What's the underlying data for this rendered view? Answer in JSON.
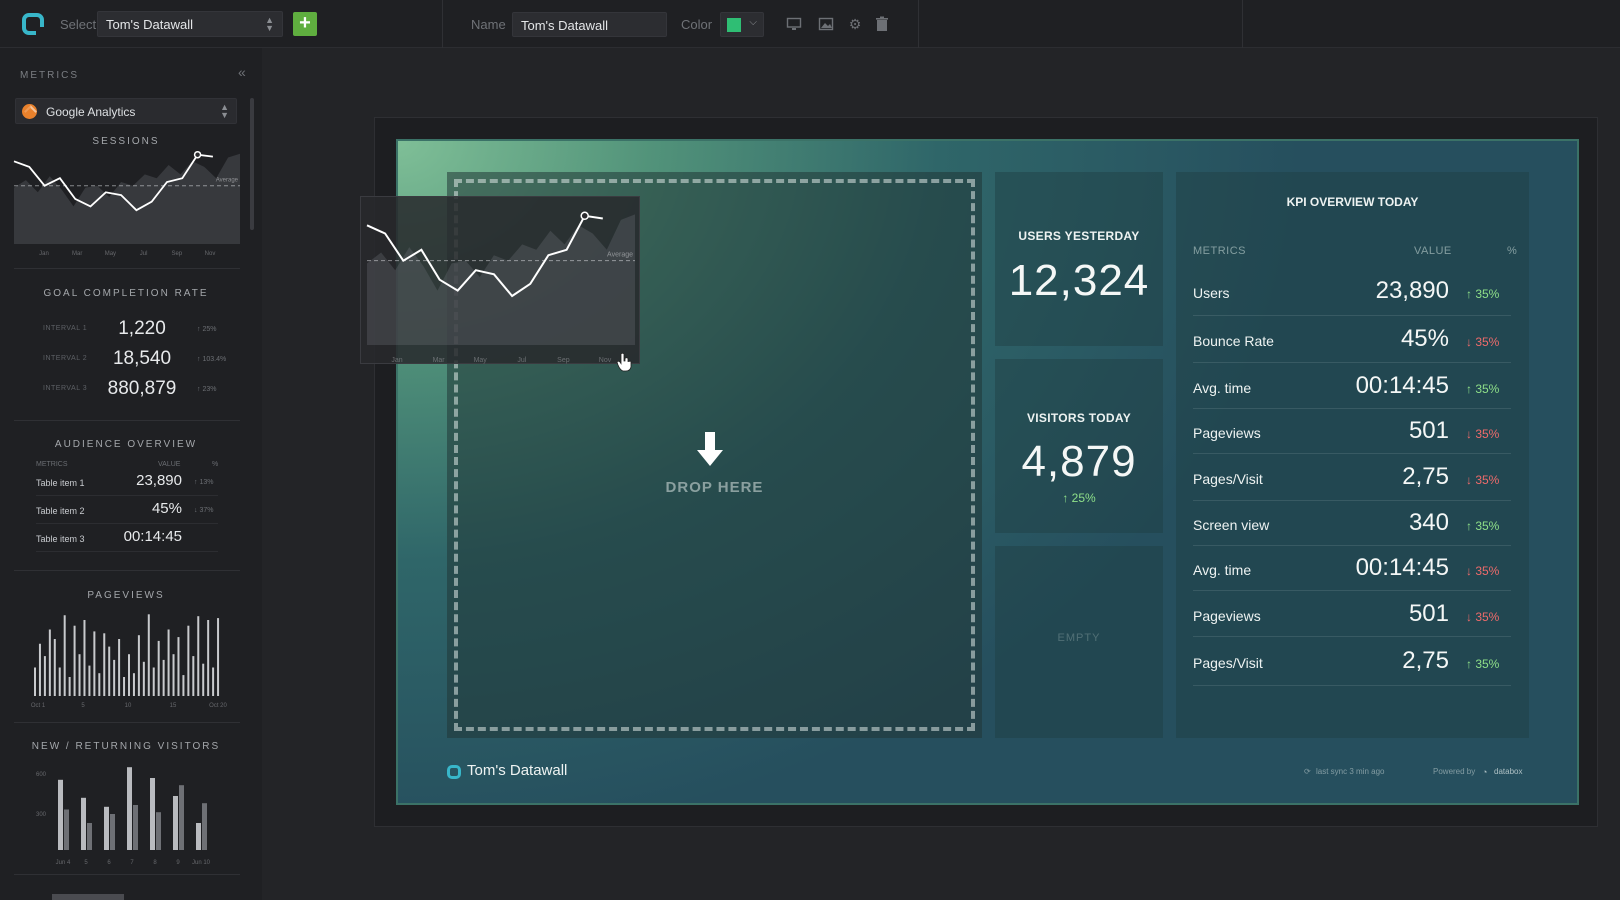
{
  "topbar": {
    "select_label": "Select",
    "select_value": "Tom's Datawall",
    "add_icon": "plus-icon",
    "name_label": "Name",
    "name_value": "Tom's Datawall",
    "color_label": "Color",
    "color_value": "#2fbe74",
    "icons": [
      "monitor-icon",
      "image-icon",
      "gear-icon",
      "trash-icon"
    ]
  },
  "sidebar": {
    "title": "METRICS",
    "collapse_icon": "double-chevron-left-icon",
    "source": "Google Analytics",
    "sessions": {
      "title": "SESSIONS",
      "average_label": "Average",
      "line": [
        88,
        82,
        62,
        70,
        48,
        40,
        55,
        52,
        36,
        45,
        66,
        70,
        95,
        93
      ],
      "area": [
        60,
        68,
        55,
        72,
        58,
        40,
        60,
        62,
        50,
        66,
        62,
        74,
        70,
        84,
        74,
        88,
        82,
        70,
        92,
        96
      ],
      "average": 62,
      "x_ticks": [
        "Jan",
        "Mar",
        "May",
        "Jul",
        "Sep",
        "Nov"
      ]
    },
    "goal_completion": {
      "title": "GOAL COMPLETION RATE",
      "rows": [
        {
          "label": "INTERVAL 1",
          "value": "1,220",
          "change": "↑ 25%"
        },
        {
          "label": "INTERVAL 2",
          "value": "18,540",
          "change": "↑ 103.4%"
        },
        {
          "label": "INTERVAL 3",
          "value": "880,879",
          "change": "↑ 23%"
        }
      ]
    },
    "audience_overview": {
      "title": "AUDIENCE OVERVIEW",
      "headers": [
        "METRICS",
        "VALUE",
        "%"
      ],
      "rows": [
        {
          "name": "Table item 1",
          "value": "23,890",
          "pct": "↑ 13%"
        },
        {
          "name": "Table item 2",
          "value": "45%",
          "pct": "↓ 37%"
        },
        {
          "name": "Table item 3",
          "value": "00:14:45",
          "pct": ""
        }
      ]
    },
    "pageviews": {
      "title": "PAGEVIEWS",
      "bars": [
        30,
        55,
        42,
        70,
        60,
        30,
        85,
        20,
        74,
        44,
        80,
        32,
        68,
        24,
        66,
        52,
        38,
        60,
        20,
        44,
        24,
        64,
        36,
        86,
        30,
        58,
        38,
        70,
        44,
        62,
        22,
        74,
        42,
        84,
        34,
        80,
        30,
        82
      ],
      "x_ticks": [
        "Oct 1",
        "5",
        "10",
        "15",
        "Oct 20"
      ]
    },
    "new_returning": {
      "title": "NEW / RETURNING VISITORS",
      "y_ticks": [
        "600",
        "300"
      ],
      "new": [
        78,
        58,
        48,
        92,
        80,
        60,
        30
      ],
      "returning": [
        45,
        30,
        40,
        50,
        42,
        72,
        52
      ],
      "x_ticks": [
        "Jun 4",
        "5",
        "6",
        "7",
        "8",
        "9",
        "Jun 10"
      ]
    }
  },
  "datawall": {
    "drop_text": "DROP HERE",
    "users_yesterday": {
      "label": "USERS YESTERDAY",
      "value": "12,324"
    },
    "visitors_today": {
      "label": "VISITORS TODAY",
      "value": "4,879",
      "change": "↑ 25%"
    },
    "empty_label": "EMPTY",
    "kpi": {
      "title": "KPI OVERVIEW TODAY",
      "headers": [
        "METRICS",
        "VALUE",
        "%"
      ],
      "rows": [
        {
          "name": "Users",
          "value": "23,890",
          "pct": "↑ 35%",
          "dir": "up"
        },
        {
          "name": "Bounce Rate",
          "value": "45%",
          "pct": "↓ 35%",
          "dir": "down"
        },
        {
          "name": "Avg. time",
          "value": "00:14:45",
          "pct": "↑ 35%",
          "dir": "up"
        },
        {
          "name": "Pageviews",
          "value": "501",
          "pct": "↓ 35%",
          "dir": "down"
        },
        {
          "name": "Pages/Visit",
          "value": "2,75",
          "pct": "↓ 35%",
          "dir": "down"
        },
        {
          "name": "Screen view",
          "value": "340",
          "pct": "↑ 35%",
          "dir": "up"
        },
        {
          "name": "Avg. time",
          "value": "00:14:45",
          "pct": "↓ 35%",
          "dir": "down"
        },
        {
          "name": "Pageviews",
          "value": "501",
          "pct": "↓ 35%",
          "dir": "down"
        },
        {
          "name": "Pages/Visit",
          "value": "2,75",
          "pct": "↑ 35%",
          "dir": "up"
        }
      ]
    },
    "footer_name": "Tom's Datawall",
    "sync_text": "last sync 3 min ago",
    "powered_text": "Powered by",
    "brand_text": "databox"
  },
  "ghost": {
    "average_label": "Average",
    "x_ticks": [
      "Jan",
      "Mar",
      "May",
      "Jul",
      "Sep",
      "Nov"
    ]
  },
  "colors": {
    "accent": "#38b6c9",
    "add_button": "#5fae3f",
    "up": "#8fe089",
    "down": "#ef6b6b"
  }
}
